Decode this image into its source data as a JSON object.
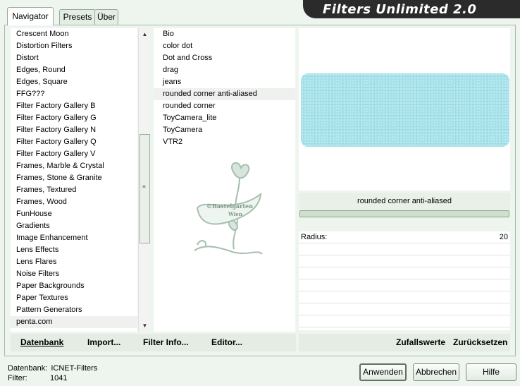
{
  "title": "Filters Unlimited 2.0",
  "tabs": [
    {
      "label": "Navigator",
      "active": true
    },
    {
      "label": "Presets",
      "active": false
    },
    {
      "label": "Über",
      "active": false
    }
  ],
  "categories": [
    "Crescent Moon",
    "Distortion Filters",
    "Distort",
    "Edges, Round",
    "Edges, Square",
    "FFG???",
    "Filter Factory Gallery B",
    "Filter Factory Gallery G",
    "Filter Factory Gallery N",
    "Filter Factory Gallery Q",
    "Filter Factory Gallery V",
    "Frames, Marble & Crystal",
    "Frames, Stone & Granite",
    "Frames, Textured",
    "Frames, Wood",
    "FunHouse",
    "Gradients",
    "Image Enhancement",
    "Lens Effects",
    "Lens Flares",
    "Noise Filters",
    "Paper Backgrounds",
    "Paper Textures",
    "Pattern Generators",
    "penta.com"
  ],
  "selected_category": "penta.com",
  "filters": [
    "Bio",
    "color dot",
    "Dot and Cross",
    "drag",
    "jeans",
    "rounded corner anti-aliased",
    "rounded corner",
    "ToyCamera_lite",
    "ToyCamera",
    "VTR2"
  ],
  "selected_filter": "rounded corner anti-aliased",
  "watermark": {
    "line1": "©Bastelgarten",
    "line2": "Wien"
  },
  "preview": {
    "filter_name": "rounded corner anti-aliased",
    "color": "#a8e2ea"
  },
  "params": [
    {
      "label": "Radius:",
      "value": "20"
    }
  ],
  "left_buttons": {
    "database": "Datenbank",
    "import": "Import...",
    "filter_info": "Filter Info...",
    "editor": "Editor..."
  },
  "right_buttons": {
    "random": "Zufallswerte",
    "reset": "Zurücksetzen"
  },
  "status": {
    "database_label": "Datenbank:",
    "database_value": "ICNET-Filters",
    "filter_label": "Filter:",
    "filter_value": "1041"
  },
  "dialog_buttons": {
    "apply": "Anwenden",
    "cancel": "Abbrechen",
    "help": "Hilfe"
  }
}
